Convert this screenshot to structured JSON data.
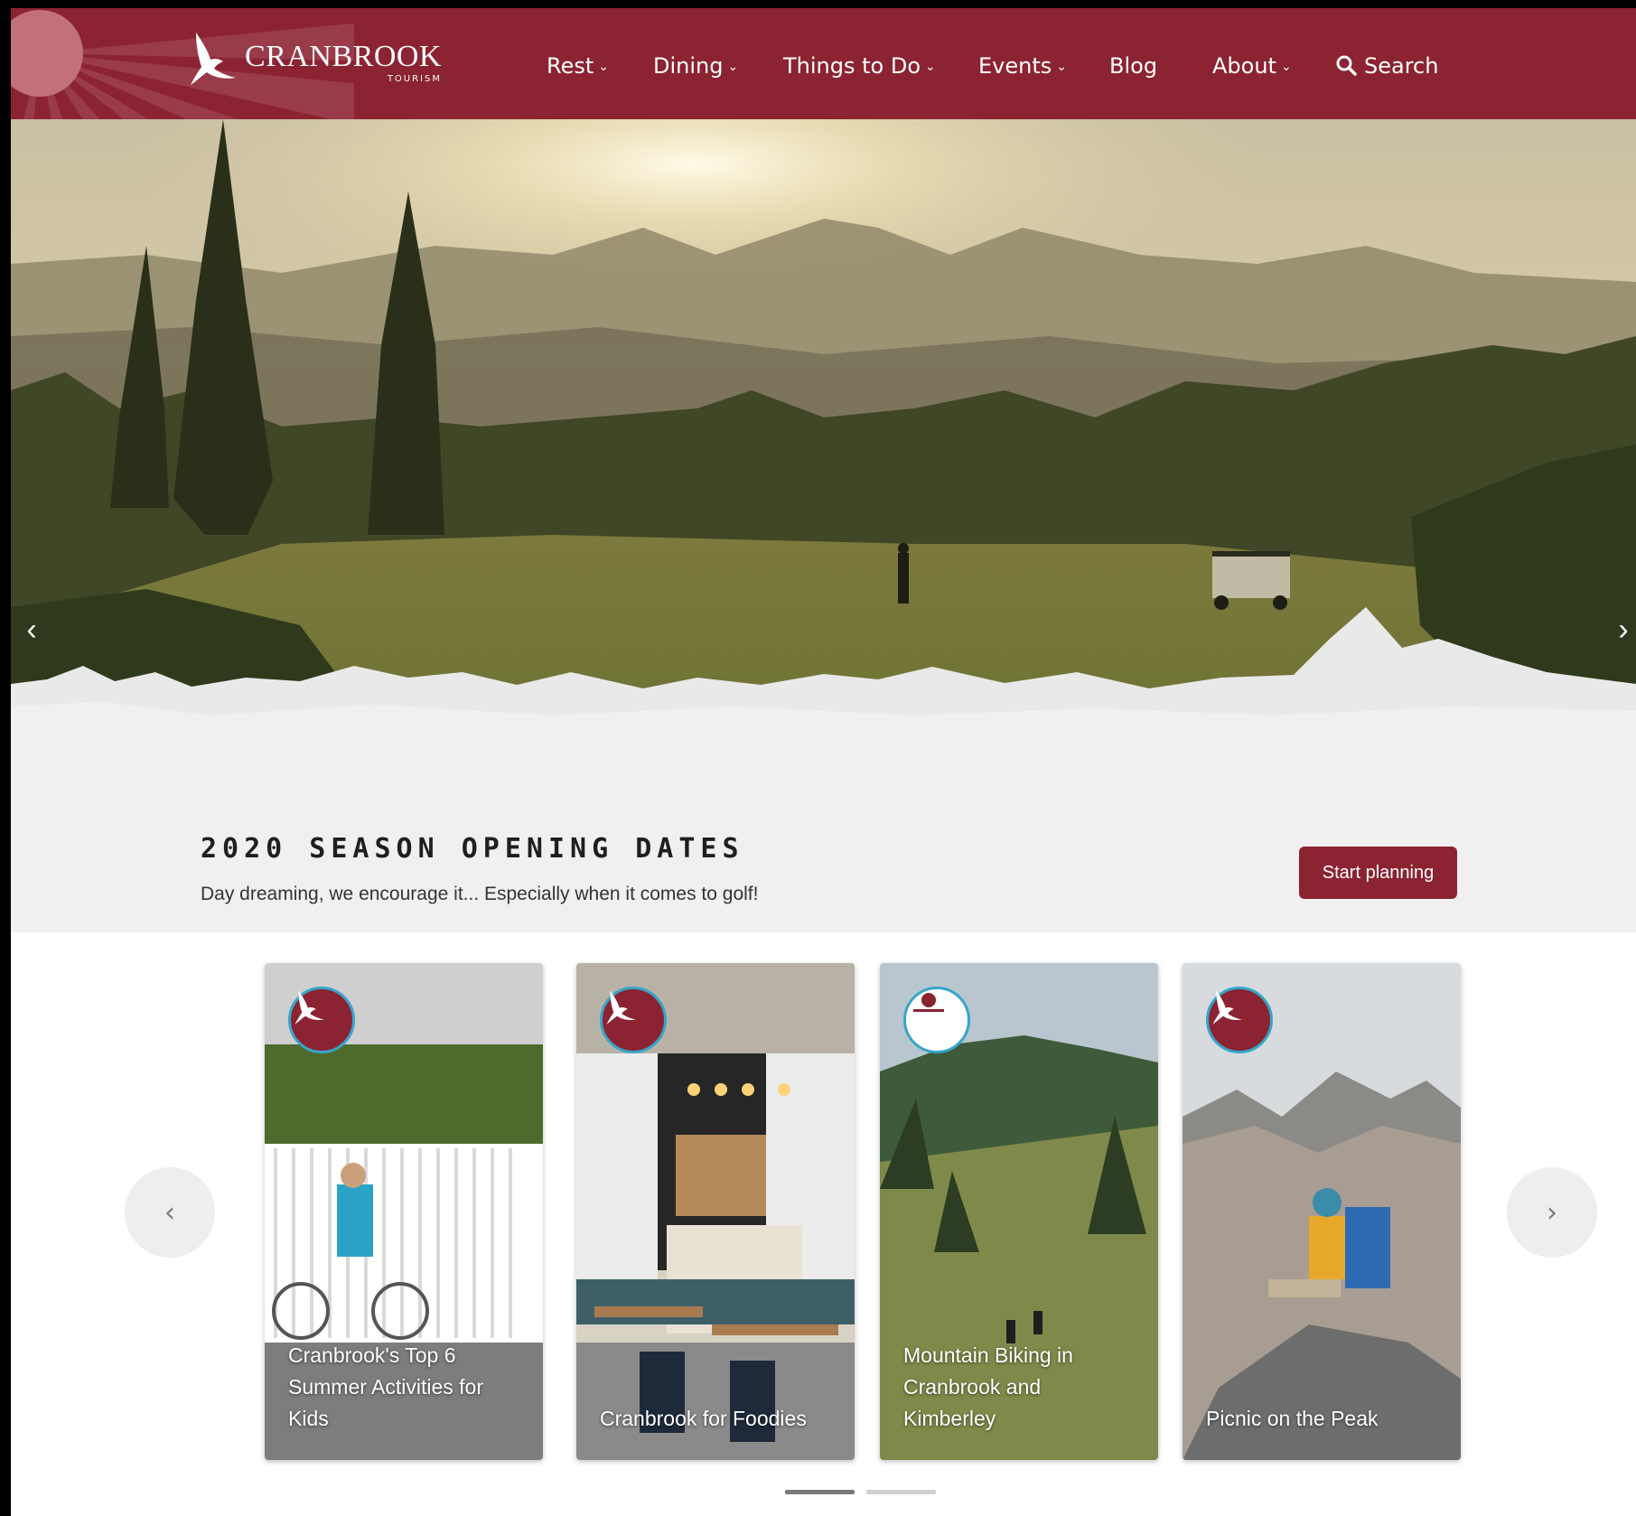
{
  "brand": {
    "name": "CRANBROOK",
    "sub": "TOURISM",
    "color": "#8b2332",
    "logo_icon": "eagle-icon"
  },
  "nav": {
    "items": [
      {
        "label": "Rest",
        "dropdown": true
      },
      {
        "label": "Dining",
        "dropdown": true
      },
      {
        "label": "Things to Do",
        "dropdown": true
      },
      {
        "label": "Events",
        "dropdown": true
      },
      {
        "label": "Blog",
        "dropdown": false
      },
      {
        "label": "About",
        "dropdown": true
      }
    ],
    "search_label": "Search",
    "search_icon": "search-icon"
  },
  "hero": {
    "title": "2020 SEASON OPENING DATES",
    "subtitle": "Day dreaming, we encourage it... Especially when it comes to golf!",
    "cta": "Start planning",
    "prev_icon": "chevron-left-icon",
    "next_icon": "chevron-right-icon"
  },
  "carousel": {
    "cards": [
      {
        "title": "Cranbrook's Top 6 Summer Activities for Kids",
        "badge": "eagle-icon"
      },
      {
        "title": "Cranbrook for Foodies",
        "badge": "eagle-icon"
      },
      {
        "title": "Mountain Biking in Cranbrook and Kimberley",
        "badge": "partner-logo-icon"
      },
      {
        "title": "Picnic on the Peak",
        "badge": "eagle-icon"
      }
    ],
    "prev_icon": "chevron-left-icon",
    "next_icon": "chevron-right-icon",
    "active_page": 1,
    "page_count": 2
  }
}
